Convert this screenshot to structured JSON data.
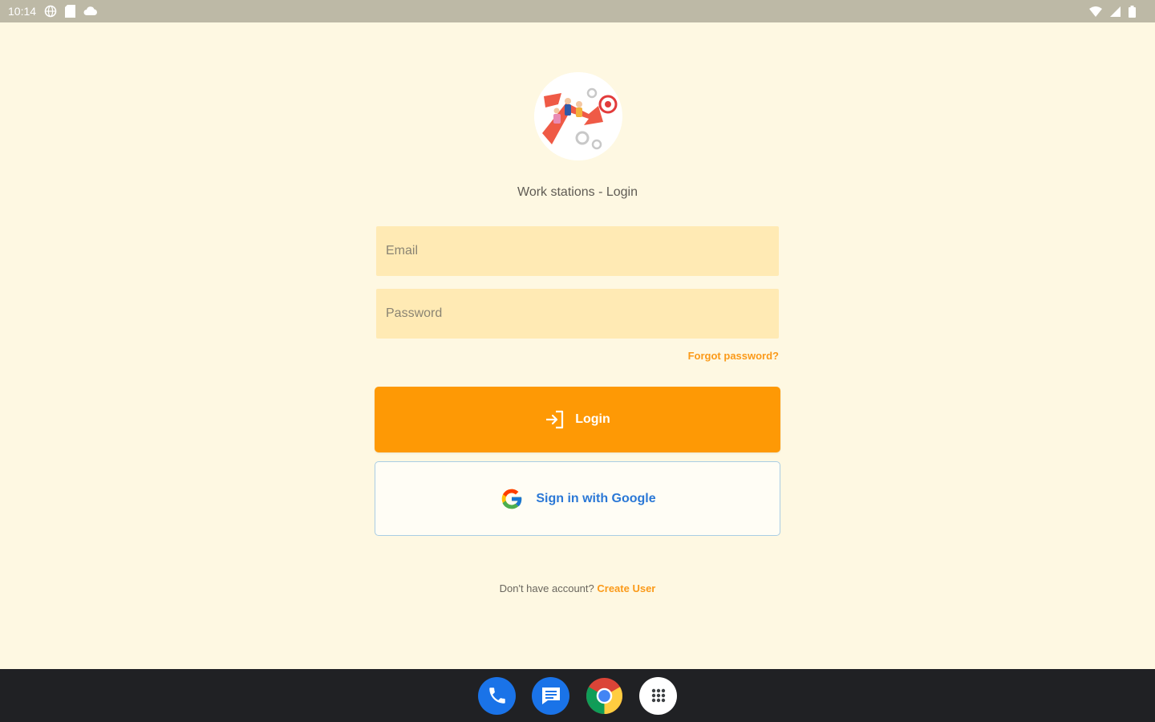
{
  "status_bar": {
    "time": "10:14",
    "left_icons": [
      "globe-icon",
      "sd-card-icon",
      "cloud-icon"
    ],
    "right_icons": [
      "wifi-icon",
      "signal-icon",
      "battery-icon"
    ]
  },
  "login": {
    "title": "Work stations - Login",
    "email_placeholder": "Email",
    "password_placeholder": "Password",
    "forgot_password": "Forgot password?",
    "login_button": "Login",
    "google_button": "Sign in with Google",
    "signup_prompt": "Don't have account?",
    "create_user": "Create User"
  },
  "taskbar": {
    "apps": [
      "phone",
      "messages",
      "chrome",
      "app-drawer"
    ]
  },
  "colors": {
    "background": "#fef8e2",
    "input_fill": "#ffeab4",
    "accent": "#fe9905",
    "link": "#fb9a19",
    "google_text": "#2b78d6",
    "status_bar": "#bdb9a6",
    "taskbar": "#202124"
  }
}
